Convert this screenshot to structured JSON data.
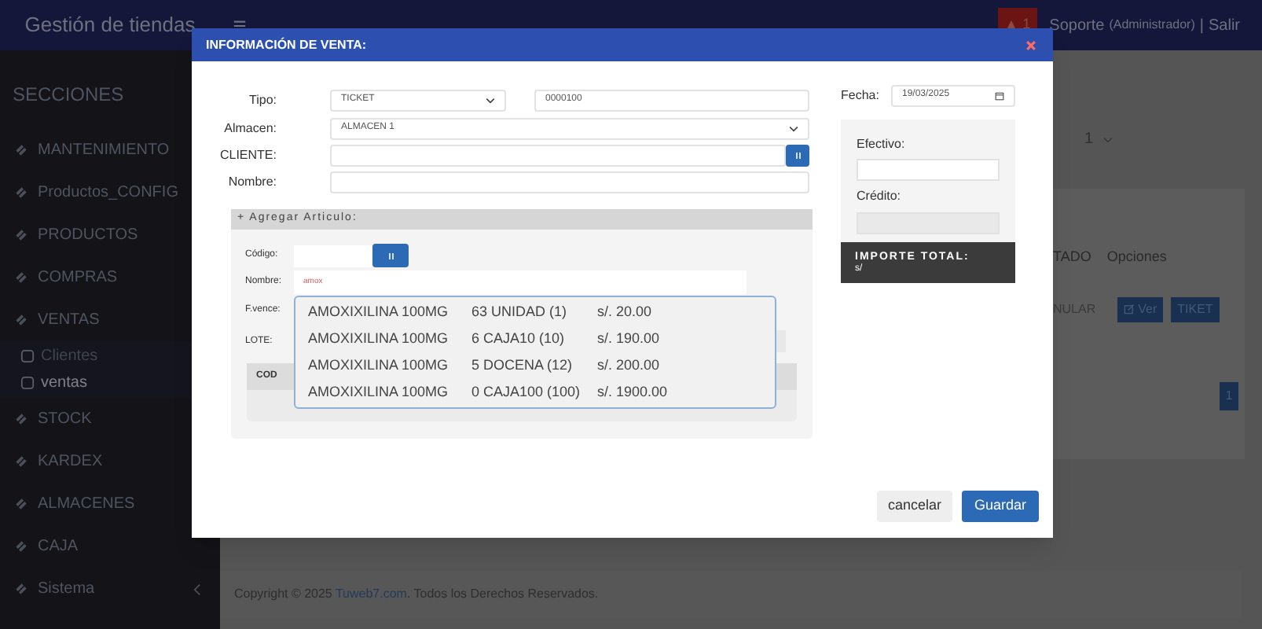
{
  "header": {
    "brand": "Gestión de tiendas",
    "alert_count": "1",
    "user": "Soporte",
    "role": "(Administrador)",
    "separator": "|",
    "logout": "Salir"
  },
  "sidebar": {
    "title": "SECCIONES",
    "items": [
      {
        "label": "MANTENIMIENTO"
      },
      {
        "label": "Productos_CONFIG"
      },
      {
        "label": "PRODUCTOS"
      },
      {
        "label": "COMPRAS"
      },
      {
        "label": "VENTAS",
        "expanded": true,
        "children": [
          {
            "label": "Clientes",
            "selected": false
          },
          {
            "label": "ventas",
            "selected": true
          }
        ]
      },
      {
        "label": "STOCK"
      },
      {
        "label": "KARDEX"
      },
      {
        "label": "ALMACENES"
      },
      {
        "label": "CAJA"
      },
      {
        "label": "Sistema",
        "expanded": false
      }
    ]
  },
  "background": {
    "page_size": "1",
    "columns": [
      "TADO",
      "Opciones"
    ],
    "row": {
      "status": "NULAR",
      "buttons": [
        "Ver",
        "TIKET"
      ]
    },
    "pagination": [
      "1"
    ]
  },
  "footer": {
    "before": "Copyright © 2025 ",
    "link": "Tuweb7.com",
    "after": ". Todos los Derechos Reservados."
  },
  "modal": {
    "title": "INFORMACIÓN DE VENTA:",
    "tipo": {
      "label": "Tipo:",
      "value": "TICKET"
    },
    "numero": "0000100",
    "almacen": {
      "label": "Almacen:",
      "value": "ALMACEN 1"
    },
    "cliente": {
      "label": "CLIENTE:"
    },
    "nombre": {
      "label": "Nombre:"
    },
    "fecha": {
      "label": "Fecha:",
      "value": "19/03/2025"
    },
    "efectivo": {
      "label": "Efectivo:"
    },
    "credito": {
      "label": "Crédito:",
      "disabled": true
    },
    "importe": {
      "label": "IMPORTE TOTAL:",
      "value": "s/"
    },
    "articulo": {
      "title": "+ Agregar Articulo:",
      "codigo_label": "Código:",
      "nombre_label": "Nombre:",
      "nombre_value": "amox",
      "fvence_label": "F.vence:",
      "lote_label": "LOTE:",
      "columns": [
        "COD"
      ],
      "suggestions": [
        {
          "name": "AMOXIXILINA 100MG",
          "qty": "63 UNIDAD (1)",
          "price": "s/. 20.00"
        },
        {
          "name": "AMOXIXILINA 100MG",
          "qty": "6 CAJA10 (10)",
          "price": "s/. 190.00"
        },
        {
          "name": "AMOXIXILINA 100MG",
          "qty": "5 DOCENA (12)",
          "price": "s/. 200.00"
        },
        {
          "name": "AMOXIXILINA 100MG",
          "qty": "0 CAJA100 (100)",
          "price": "s/. 1900.00"
        }
      ]
    },
    "buttons": {
      "cancel": "cancelar",
      "save": "Guardar"
    }
  }
}
